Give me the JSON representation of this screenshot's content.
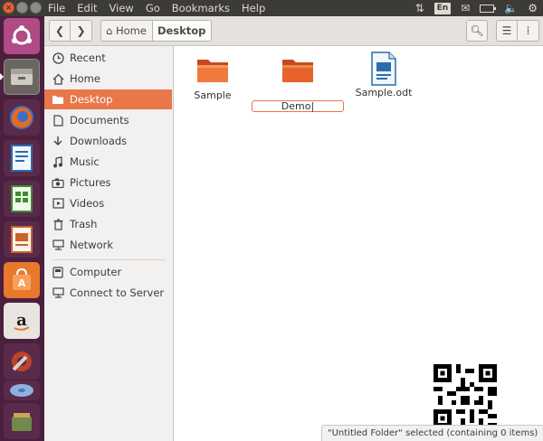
{
  "menubar": {
    "items": [
      "File",
      "Edit",
      "View",
      "Go",
      "Bookmarks",
      "Help"
    ],
    "language": "En"
  },
  "window_controls": {
    "close": "×"
  },
  "launcher": {
    "items": [
      {
        "name": "ubuntu-dash-icon",
        "bg": "#b04b86"
      },
      {
        "name": "files-icon",
        "bg": "#6a6560",
        "active": true
      },
      {
        "name": "firefox-icon",
        "bg": "#e66a1f"
      },
      {
        "name": "writer-icon",
        "bg": "#2b6cb0"
      },
      {
        "name": "calc-icon",
        "bg": "#3c8d2f"
      },
      {
        "name": "impress-icon",
        "bg": "#c8632a"
      },
      {
        "name": "software-center-icon",
        "bg": "#e8782c"
      },
      {
        "name": "amazon-icon",
        "bg": "#e8e4df"
      },
      {
        "name": "system-settings-icon",
        "bg": "#b9462a"
      },
      {
        "name": "disk-icon",
        "bg": "#4b78b5"
      },
      {
        "name": "trash-launcher-icon",
        "bg": "#6f8a4a"
      }
    ]
  },
  "toolbar": {
    "path": [
      "Home",
      "Desktop"
    ]
  },
  "sidebar": {
    "items": [
      {
        "label": "Recent",
        "icon": "clock-icon"
      },
      {
        "label": "Home",
        "icon": "home-icon"
      },
      {
        "label": "Desktop",
        "icon": "folder-icon",
        "active": true
      },
      {
        "label": "Documents",
        "icon": "document-icon"
      },
      {
        "label": "Downloads",
        "icon": "download-icon"
      },
      {
        "label": "Music",
        "icon": "music-icon"
      },
      {
        "label": "Pictures",
        "icon": "camera-icon"
      },
      {
        "label": "Videos",
        "icon": "video-icon"
      },
      {
        "label": "Trash",
        "icon": "trash-icon"
      },
      {
        "label": "Network",
        "icon": "network-icon"
      }
    ],
    "devices": [
      {
        "label": "Computer",
        "icon": "computer-icon"
      },
      {
        "label": "Connect to Server",
        "icon": "server-icon"
      }
    ]
  },
  "files": [
    {
      "name": "Sample",
      "type": "folder"
    },
    {
      "name": "Demo",
      "type": "folder",
      "renaming": true
    },
    {
      "name": "Sample.odt",
      "type": "document"
    }
  ],
  "status": "\"Untitled Folder\" selected (containing 0 items)",
  "colors": {
    "accent": "#e8774a",
    "panel": "#3c3b37",
    "launcher": "#4b1f3e"
  }
}
